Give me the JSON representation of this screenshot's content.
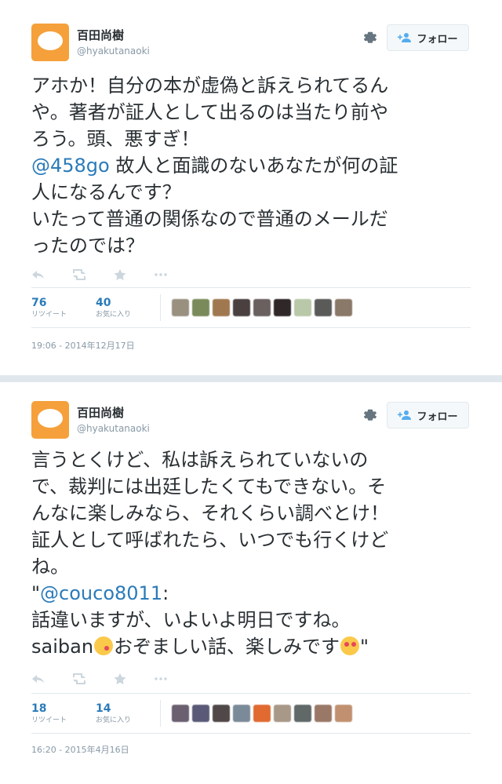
{
  "colors": {
    "accent": "#2b7bb9",
    "muted": "#8899a6",
    "avatar_bg": "#f5a03a",
    "separator": "#e1e8ed"
  },
  "tweets": [
    {
      "user": {
        "name": "百田尚樹",
        "handle": "@hyakutanaoki",
        "avatar_icon": "default-egg-avatar"
      },
      "follow_label": "フォロー",
      "lines": [
        "アホか！自分の本が虚偽と訴えられてるん",
        "や。著者が証人として出るのは当たり前や",
        "ろう。頭、悪すぎ！"
      ],
      "mention": "@458go",
      "lines_after_mention": [
        " 故人と面識のないあなたが何の証",
        "人になるんです？",
        "いたって普通の関係なので普通のメールだ",
        "ったのでは？"
      ],
      "actions": [
        "reply-icon",
        "retweet-icon",
        "favorite-icon",
        "more-icon"
      ],
      "retweets": {
        "count": "76",
        "label": "リツイート"
      },
      "favorites": {
        "count": "40",
        "label": "お気に入り"
      },
      "face_colors": [
        "#9a9080",
        "#7a8a5a",
        "#a07850",
        "#4a4040",
        "#6a6060",
        "#302828",
        "#b8c8a8",
        "#5a5a58",
        "#8a7868"
      ],
      "timestamp": "19:06 - 2014年12月17日"
    },
    {
      "user": {
        "name": "百田尚樹",
        "handle": "@hyakutanaoki",
        "avatar_icon": "default-egg-avatar"
      },
      "follow_label": "フォロー",
      "lines": [
        "言うとくけど、私は訴えられていないの",
        "で、裁判には出廷したくてもできない。そ",
        "んなに楽しみなら、それくらい調べとけ！",
        "証人として呼ばれたら、いつでも行くけど",
        "ね。"
      ],
      "quote_open": "\"",
      "mention": "@couco8011",
      "mention_suffix": ":",
      "lines_after_mention": [
        "話違いますが、いよいよ明日ですね。"
      ],
      "last_line": {
        "pre": "saiban",
        "emoji1": "kissing-heart-emoji",
        "mid": "おぞましい話、楽しみです",
        "emoji2": "heart-eyes-emoji",
        "post": "\""
      },
      "actions": [
        "reply-icon",
        "retweet-icon",
        "favorite-icon",
        "more-icon"
      ],
      "retweets": {
        "count": "18",
        "label": "リツイート"
      },
      "favorites": {
        "count": "14",
        "label": "お気に入り"
      },
      "face_colors": [
        "#6a6070",
        "#5a5a78",
        "#504848",
        "#7a8a98",
        "#e06a30",
        "#a89888",
        "#606868",
        "#9a7868",
        "#c09070"
      ],
      "timestamp": "16:20 - 2015年4月16日"
    }
  ]
}
